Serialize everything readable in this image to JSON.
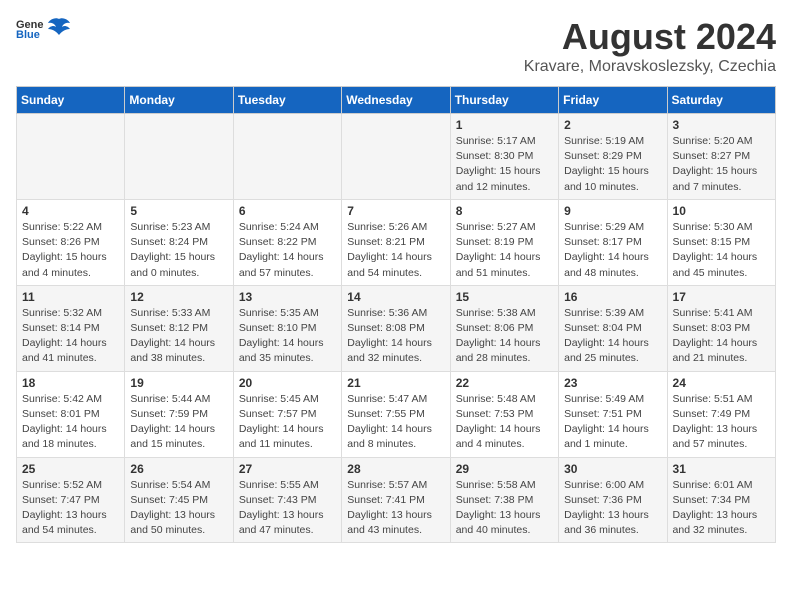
{
  "header": {
    "logo_general": "General",
    "logo_blue": "Blue",
    "title": "August 2024",
    "subtitle": "Kravare, Moravskoslezsky, Czechia"
  },
  "calendar": {
    "days_of_week": [
      "Sunday",
      "Monday",
      "Tuesday",
      "Wednesday",
      "Thursday",
      "Friday",
      "Saturday"
    ],
    "weeks": [
      [
        {
          "day": "",
          "info": ""
        },
        {
          "day": "",
          "info": ""
        },
        {
          "day": "",
          "info": ""
        },
        {
          "day": "",
          "info": ""
        },
        {
          "day": "1",
          "info": "Sunrise: 5:17 AM\nSunset: 8:30 PM\nDaylight: 15 hours and 12 minutes."
        },
        {
          "day": "2",
          "info": "Sunrise: 5:19 AM\nSunset: 8:29 PM\nDaylight: 15 hours and 10 minutes."
        },
        {
          "day": "3",
          "info": "Sunrise: 5:20 AM\nSunset: 8:27 PM\nDaylight: 15 hours and 7 minutes."
        }
      ],
      [
        {
          "day": "4",
          "info": "Sunrise: 5:22 AM\nSunset: 8:26 PM\nDaylight: 15 hours and 4 minutes."
        },
        {
          "day": "5",
          "info": "Sunrise: 5:23 AM\nSunset: 8:24 PM\nDaylight: 15 hours and 0 minutes."
        },
        {
          "day": "6",
          "info": "Sunrise: 5:24 AM\nSunset: 8:22 PM\nDaylight: 14 hours and 57 minutes."
        },
        {
          "day": "7",
          "info": "Sunrise: 5:26 AM\nSunset: 8:21 PM\nDaylight: 14 hours and 54 minutes."
        },
        {
          "day": "8",
          "info": "Sunrise: 5:27 AM\nSunset: 8:19 PM\nDaylight: 14 hours and 51 minutes."
        },
        {
          "day": "9",
          "info": "Sunrise: 5:29 AM\nSunset: 8:17 PM\nDaylight: 14 hours and 48 minutes."
        },
        {
          "day": "10",
          "info": "Sunrise: 5:30 AM\nSunset: 8:15 PM\nDaylight: 14 hours and 45 minutes."
        }
      ],
      [
        {
          "day": "11",
          "info": "Sunrise: 5:32 AM\nSunset: 8:14 PM\nDaylight: 14 hours and 41 minutes."
        },
        {
          "day": "12",
          "info": "Sunrise: 5:33 AM\nSunset: 8:12 PM\nDaylight: 14 hours and 38 minutes."
        },
        {
          "day": "13",
          "info": "Sunrise: 5:35 AM\nSunset: 8:10 PM\nDaylight: 14 hours and 35 minutes."
        },
        {
          "day": "14",
          "info": "Sunrise: 5:36 AM\nSunset: 8:08 PM\nDaylight: 14 hours and 32 minutes."
        },
        {
          "day": "15",
          "info": "Sunrise: 5:38 AM\nSunset: 8:06 PM\nDaylight: 14 hours and 28 minutes."
        },
        {
          "day": "16",
          "info": "Sunrise: 5:39 AM\nSunset: 8:04 PM\nDaylight: 14 hours and 25 minutes."
        },
        {
          "day": "17",
          "info": "Sunrise: 5:41 AM\nSunset: 8:03 PM\nDaylight: 14 hours and 21 minutes."
        }
      ],
      [
        {
          "day": "18",
          "info": "Sunrise: 5:42 AM\nSunset: 8:01 PM\nDaylight: 14 hours and 18 minutes."
        },
        {
          "day": "19",
          "info": "Sunrise: 5:44 AM\nSunset: 7:59 PM\nDaylight: 14 hours and 15 minutes."
        },
        {
          "day": "20",
          "info": "Sunrise: 5:45 AM\nSunset: 7:57 PM\nDaylight: 14 hours and 11 minutes."
        },
        {
          "day": "21",
          "info": "Sunrise: 5:47 AM\nSunset: 7:55 PM\nDaylight: 14 hours and 8 minutes."
        },
        {
          "day": "22",
          "info": "Sunrise: 5:48 AM\nSunset: 7:53 PM\nDaylight: 14 hours and 4 minutes."
        },
        {
          "day": "23",
          "info": "Sunrise: 5:49 AM\nSunset: 7:51 PM\nDaylight: 14 hours and 1 minute."
        },
        {
          "day": "24",
          "info": "Sunrise: 5:51 AM\nSunset: 7:49 PM\nDaylight: 13 hours and 57 minutes."
        }
      ],
      [
        {
          "day": "25",
          "info": "Sunrise: 5:52 AM\nSunset: 7:47 PM\nDaylight: 13 hours and 54 minutes."
        },
        {
          "day": "26",
          "info": "Sunrise: 5:54 AM\nSunset: 7:45 PM\nDaylight: 13 hours and 50 minutes."
        },
        {
          "day": "27",
          "info": "Sunrise: 5:55 AM\nSunset: 7:43 PM\nDaylight: 13 hours and 47 minutes."
        },
        {
          "day": "28",
          "info": "Sunrise: 5:57 AM\nSunset: 7:41 PM\nDaylight: 13 hours and 43 minutes."
        },
        {
          "day": "29",
          "info": "Sunrise: 5:58 AM\nSunset: 7:38 PM\nDaylight: 13 hours and 40 minutes."
        },
        {
          "day": "30",
          "info": "Sunrise: 6:00 AM\nSunset: 7:36 PM\nDaylight: 13 hours and 36 minutes."
        },
        {
          "day": "31",
          "info": "Sunrise: 6:01 AM\nSunset: 7:34 PM\nDaylight: 13 hours and 32 minutes."
        }
      ]
    ]
  }
}
